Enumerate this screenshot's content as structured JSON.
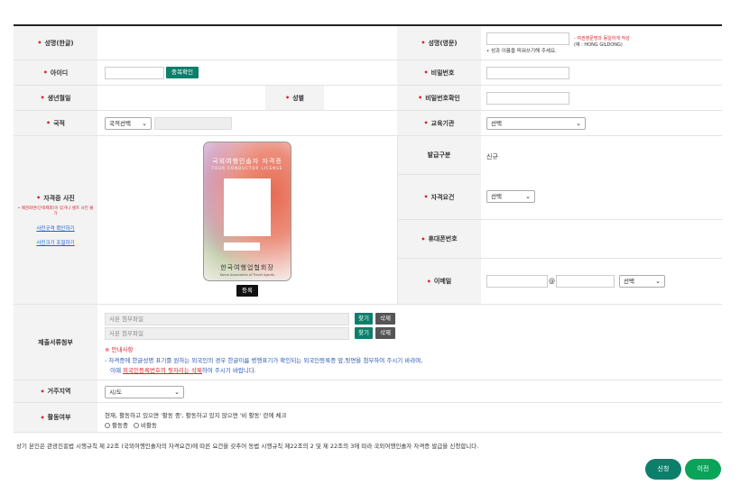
{
  "labels": {
    "name_kr": "성명(한글)",
    "name_en": "성명(영문)",
    "user_id": "아이디",
    "password": "비밀번호",
    "birth": "생년월일",
    "gender": "성별",
    "password_confirm": "비밀번호확인",
    "nationality": "국적",
    "edu_institution": "교육기관",
    "issue_type": "발급구분",
    "license_photo": "자격증 사진",
    "qualification": "자격요건",
    "mobile": "휴대폰번호",
    "email": "이메일",
    "attachments": "제출서류첨부",
    "region": "거주지역",
    "activity": "활동여부"
  },
  "name_en": {
    "hint_red": "- 여권영문명과 동일하게 작성",
    "hint_example": "(예 : HONG GILDONG)",
    "hint_space": "• 성과 이름을 띄워쓰기해 주세요."
  },
  "user_id": {
    "dup_check_button": "중복확인"
  },
  "nationality": {
    "select_value": "국적선택"
  },
  "edu_institution": {
    "select_value": "선택"
  },
  "issue_type": {
    "value": "신규"
  },
  "qualification": {
    "select_value": "선택"
  },
  "email": {
    "at": "@",
    "domain_select": "선택"
  },
  "photo": {
    "warning": "• 배경화면(단색제외)이 있거나 셀프 사진 불가",
    "link_spec": "사진규격 확인하기",
    "link_resize": "사진크기 조절하기",
    "card_title": "국외여행인솔자 자격증",
    "card_subtitle": "TOUR CONDUCTOR LICENSE",
    "card_org": "한국여행업협회장",
    "card_org_en": "Korea Association of Travel Agents",
    "register_button": "등록"
  },
  "attachments": {
    "file1_placeholder": "사본 첨부파일",
    "file2_placeholder": "사본 첨부파일",
    "find_button": "찾기",
    "delete_button": "삭제",
    "notice_title": "※ 안내사항",
    "notice_line1": "- 자격증에 한글성명 표기를 원하는 외국인의 경우 한글이름 병행표기가 확인되는 외국인등록증 앞,뒷면을 첨부하여 주시기 바라며,",
    "notice_line2_pre": "이때",
    "notice_line2_link": "외국인등록번호의 뒷자리는 삭제",
    "notice_line2_post": "하여 주시기 바랍니다."
  },
  "region": {
    "select_value": "시/도"
  },
  "activity": {
    "description": "현재, 활동하고 있으면 '활동 중', 활동하고 있지 않으면 '비 활동' 란에 체크",
    "option_active": "활동중",
    "option_inactive": "비활동"
  },
  "footer": {
    "statement": "상기 본인은 관광진흥법 시행규칙 제 22조 (국외여행인솔자의 자격요건)에 따른 요건을 갖추어 동법 시행규칙 제22조의 2 및 제 22조의 3에 따라 국외여행인솔자 자격증 발급을 신청합니다.",
    "apply_button": "신청",
    "prev_button": "이전"
  },
  "colors": {
    "accent": "#0c7f6b",
    "button_green": "#0aa35a",
    "required": "#d9232f"
  }
}
